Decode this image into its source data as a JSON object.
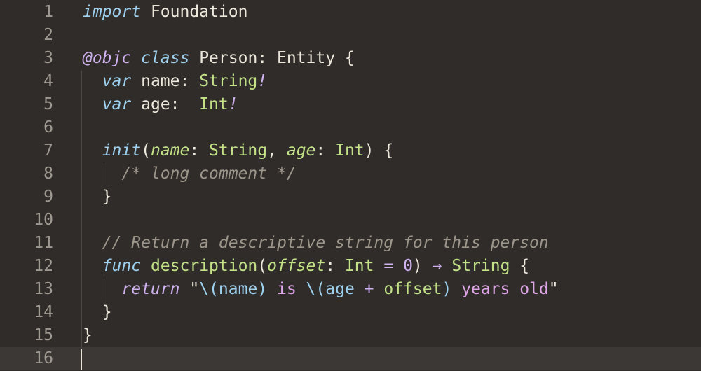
{
  "editor": {
    "lines": [
      {
        "num": "1",
        "tokens": [
          {
            "t": "import",
            "c": "kw"
          },
          {
            "t": " Foundation",
            "c": "plain"
          }
        ]
      },
      {
        "num": "2",
        "tokens": []
      },
      {
        "num": "3",
        "tokens": [
          {
            "t": "@objc",
            "c": "attr"
          },
          {
            "t": " ",
            "c": "plain"
          },
          {
            "t": "class",
            "c": "kw"
          },
          {
            "t": " Person: Entity {",
            "c": "plain"
          }
        ]
      },
      {
        "num": "4",
        "tokens": [
          {
            "t": "  ",
            "c": "plain"
          },
          {
            "t": "var",
            "c": "kw"
          },
          {
            "t": " name: ",
            "c": "plain"
          },
          {
            "t": "String",
            "c": "type"
          },
          {
            "t": "!",
            "c": "bang"
          }
        ]
      },
      {
        "num": "5",
        "tokens": [
          {
            "t": "  ",
            "c": "plain"
          },
          {
            "t": "var",
            "c": "kw"
          },
          {
            "t": " age:  ",
            "c": "plain"
          },
          {
            "t": "Int",
            "c": "type"
          },
          {
            "t": "!",
            "c": "bang"
          }
        ]
      },
      {
        "num": "6",
        "tokens": []
      },
      {
        "num": "7",
        "tokens": [
          {
            "t": "  ",
            "c": "plain"
          },
          {
            "t": "init",
            "c": "kw"
          },
          {
            "t": "(",
            "c": "plain"
          },
          {
            "t": "name",
            "c": "param"
          },
          {
            "t": ": ",
            "c": "plain"
          },
          {
            "t": "String",
            "c": "type"
          },
          {
            "t": ", ",
            "c": "plain"
          },
          {
            "t": "age",
            "c": "param"
          },
          {
            "t": ": ",
            "c": "plain"
          },
          {
            "t": "Int",
            "c": "type"
          },
          {
            "t": ") {",
            "c": "plain"
          }
        ]
      },
      {
        "num": "8",
        "tokens": [
          {
            "t": "    ",
            "c": "plain"
          },
          {
            "t": "/* long comment */",
            "c": "comment"
          }
        ]
      },
      {
        "num": "9",
        "tokens": [
          {
            "t": "  }",
            "c": "plain"
          }
        ]
      },
      {
        "num": "10",
        "tokens": []
      },
      {
        "num": "11",
        "tokens": [
          {
            "t": "  ",
            "c": "plain"
          },
          {
            "t": "// Return a descriptive string for this person",
            "c": "comment"
          }
        ]
      },
      {
        "num": "12",
        "tokens": [
          {
            "t": "  ",
            "c": "plain"
          },
          {
            "t": "func",
            "c": "kw"
          },
          {
            "t": " ",
            "c": "plain"
          },
          {
            "t": "description",
            "c": "fn"
          },
          {
            "t": "(",
            "c": "plain"
          },
          {
            "t": "offset",
            "c": "param"
          },
          {
            "t": ": ",
            "c": "plain"
          },
          {
            "t": "Int",
            "c": "type"
          },
          {
            "t": " ",
            "c": "plain"
          },
          {
            "t": "=",
            "c": "op"
          },
          {
            "t": " ",
            "c": "plain"
          },
          {
            "t": "0",
            "c": "num"
          },
          {
            "t": ") ",
            "c": "plain"
          },
          {
            "t": "→",
            "c": "op"
          },
          {
            "t": " ",
            "c": "plain"
          },
          {
            "t": "String",
            "c": "type"
          },
          {
            "t": " {",
            "c": "plain"
          }
        ]
      },
      {
        "num": "13",
        "tokens": [
          {
            "t": "    ",
            "c": "plain"
          },
          {
            "t": "return",
            "c": "attr"
          },
          {
            "t": " ",
            "c": "plain"
          },
          {
            "t": "\"",
            "c": "plain"
          },
          {
            "t": "\\(",
            "c": "interp"
          },
          {
            "t": "name",
            "c": "interp"
          },
          {
            "t": ")",
            "c": "interp"
          },
          {
            "t": " is ",
            "c": "str"
          },
          {
            "t": "\\(",
            "c": "interp"
          },
          {
            "t": "age",
            "c": "interp"
          },
          {
            "t": " + ",
            "c": "op"
          },
          {
            "t": "offset",
            "c": "interpv"
          },
          {
            "t": ")",
            "c": "interp"
          },
          {
            "t": " years old",
            "c": "str"
          },
          {
            "t": "\"",
            "c": "plain"
          }
        ]
      },
      {
        "num": "14",
        "tokens": [
          {
            "t": "  }",
            "c": "plain"
          }
        ]
      },
      {
        "num": "15",
        "tokens": [
          {
            "t": "}",
            "c": "plain"
          }
        ]
      },
      {
        "num": "16",
        "tokens": []
      }
    ],
    "current_line": 16,
    "colors": {
      "background": "#2f2c2a",
      "current_line_bg": "#3b3835",
      "line_number": "#9f9a91",
      "keyword": "#9ed1ef",
      "attribute": "#cfb2ef",
      "type": "#c3e287",
      "comment": "#9c958a",
      "string": "#e0a4e8"
    }
  }
}
